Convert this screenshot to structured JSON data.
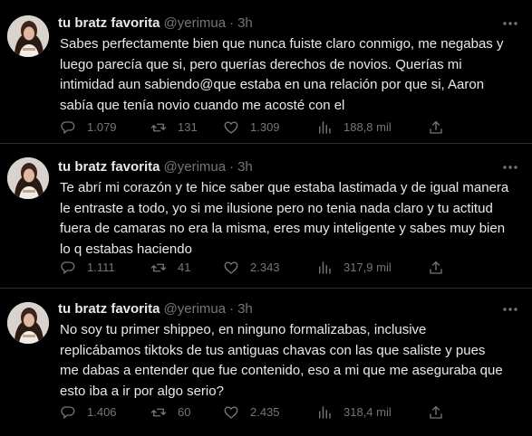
{
  "tweets": [
    {
      "author": {
        "name": "tu bratz favorita",
        "handle": "@yerimua",
        "time": "3h"
      },
      "text": "Sabes perfectamente bien que nunca fuiste claro conmigo, me negabas y\nluego parecía que si, pero querías derechos de novios. Querías mi\nintimidad aun sabiendo@que estaba en una relación por que si, Aaron\nsabía que tenía novio cuando me acosté con el",
      "stats": {
        "replies": "1.079",
        "retweets": "131",
        "likes": "1.309",
        "views": "188,8 mil"
      }
    },
    {
      "author": {
        "name": "tu bratz favorita",
        "handle": "@yerimua",
        "time": "3h"
      },
      "text": "Te abrí mi corazón y te hice saber que estaba lastimada y de igual manera\nle entraste a todo, yo si me ilusione pero no tenia nada claro y tu actitud\nfuera de camaras no era la misma, eres muy inteligente y sabes muy bien\nlo q estabas haciendo",
      "stats": {
        "replies": "1.111",
        "retweets": "41",
        "likes": "2.343",
        "views": "317,9 mil"
      }
    },
    {
      "author": {
        "name": "tu bratz favorita",
        "handle": "@yerimua",
        "time": "3h"
      },
      "text": "No soy tu primer shippeo, en ninguno formalizabas, inclusive\nreplicábamos tiktoks de tus antiguas chavas con las que saliste y pues\nme dabas a entender que fue contenido, eso a mi que me aseguraba que\nesto iba a ir por algo serio?",
      "stats": {
        "replies": "1.406",
        "retweets": "60",
        "likes": "2.435",
        "views": "318,4 mil"
      }
    }
  ],
  "separator": "·",
  "icons": {
    "more": "more-horizontal-icon",
    "reply": "reply-icon",
    "retweet": "retweet-icon",
    "like": "heart-icon",
    "views": "views-chart-icon",
    "share": "share-icon"
  },
  "colors": {
    "background": "#000000",
    "text": "#e7e9ea",
    "secondary": "#71767b",
    "divider": "#2f3336"
  }
}
